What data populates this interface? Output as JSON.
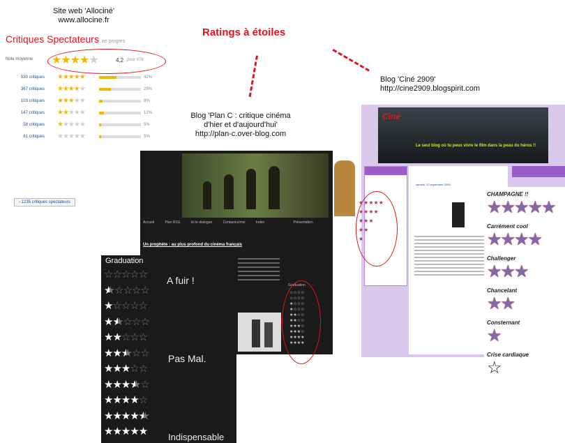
{
  "captions": {
    "allocine": "Site web 'Allociné'\nwww.allocine.fr",
    "title": "Ratings à étoiles",
    "planc": "Blog 'Plan C : critique cinéma\nd'hier et d'aujourd'hui'\nhttp://plan-c.over-blog.com",
    "cine": "Blog 'Ciné 2909'\nhttp://cine2909.blogspirit.com"
  },
  "allocine": {
    "header": "Critiques Spectateurs",
    "header_small": "en progrès",
    "avg_label": "Note moyenne",
    "avg_value": "4,2",
    "avg_suffix": "pour 978",
    "rows": [
      {
        "label": "530 critiques",
        "stars": 5,
        "pct": "42%",
        "fill": 0.42
      },
      {
        "label": "367 critiques",
        "stars": 4,
        "pct": "29%",
        "fill": 0.29
      },
      {
        "label": "103 critiques",
        "stars": 3,
        "pct": "8%",
        "fill": 0.08
      },
      {
        "label": "147 critiques",
        "stars": 2,
        "pct": "12%",
        "fill": 0.12
      },
      {
        "label": "58 critiques",
        "stars": 1,
        "pct": "5%",
        "fill": 0.05
      },
      {
        "label": "61 critiques",
        "stars": 0,
        "pct": "5%",
        "fill": 0.05
      }
    ],
    "button": "1235 critiques spectateurs"
  },
  "planc": {
    "nav": [
      "Accueil",
      "Plan RSS",
      "Ici le dialogue",
      "Contactez/moi",
      "Index",
      "Présentation"
    ],
    "post_title": "Un prophète : au plus profond du cinéma français",
    "side_label": "Graduation"
  },
  "graduation": {
    "title": "Graduation",
    "rows": [
      0,
      0.5,
      1,
      1.5,
      2,
      2.5,
      3,
      3.5,
      4,
      4.5,
      5
    ],
    "labels": {
      "afuir": "A fuir !",
      "pasmal": "Pas Mal.",
      "indisp": "Indispensable"
    }
  },
  "cine": {
    "banner": "Le seul blog où tu peux vivre le film dans la peau du héros !!",
    "levels": [
      {
        "stars": 5,
        "label": "CHAMPAGNE !!"
      },
      {
        "stars": 4,
        "label": "Carrément cool"
      },
      {
        "stars": 3,
        "label": "Challenger"
      },
      {
        "stars": 2,
        "label": "Chancelant"
      },
      {
        "stars": 1,
        "label": "Consternant"
      },
      {
        "stars": 0,
        "label": "Crise cardiaque"
      }
    ],
    "post_date": "samedi, 12 septembre 2009"
  }
}
